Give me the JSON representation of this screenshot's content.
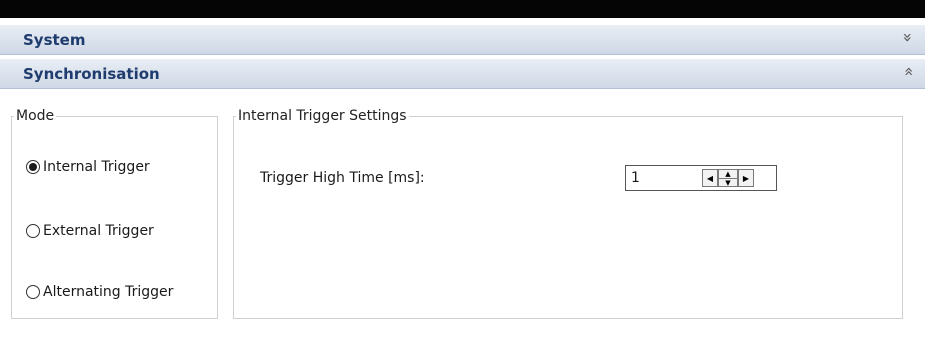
{
  "sections": {
    "system": {
      "title": "System",
      "chevron": "≫"
    },
    "synchronisation": {
      "title": "Synchronisation",
      "chevron": "≪"
    }
  },
  "mode": {
    "legend": "Mode",
    "options": [
      {
        "label": "Internal Trigger",
        "checked": true
      },
      {
        "label": "External Trigger",
        "checked": false
      },
      {
        "label": "Alternating Trigger",
        "checked": false
      }
    ]
  },
  "internal_trigger": {
    "legend": "Internal Trigger Settings",
    "high_time_label": "Trigger High Time [ms]:",
    "high_time_value": "1"
  },
  "icons": {
    "expand": "chevron-double-down-icon",
    "collapse": "chevron-double-up-icon",
    "spin_left": "triangle-left-icon",
    "spin_up": "triangle-up-icon",
    "spin_down": "triangle-down-icon",
    "spin_right": "triangle-right-icon"
  }
}
